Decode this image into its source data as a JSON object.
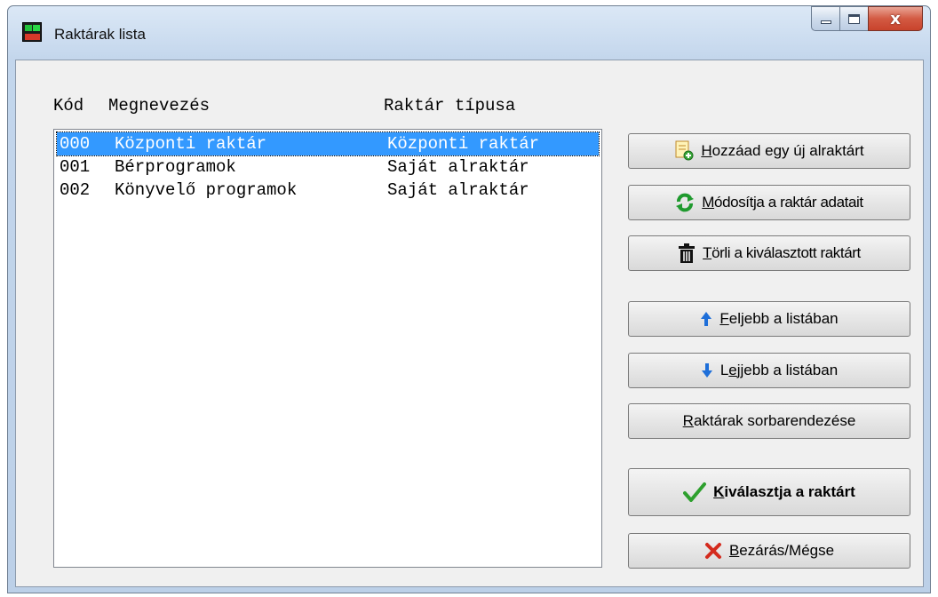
{
  "window": {
    "title": "Raktárak lista",
    "close_glyph": "x"
  },
  "list": {
    "headers": {
      "code": "Kód",
      "name": "Megnevezés",
      "type": "Raktár típusa"
    },
    "rows": [
      {
        "code": "000",
        "name": "Központi raktár",
        "type": "Központi raktár",
        "selected": true
      },
      {
        "code": "001",
        "name": "Bérprogramok",
        "type": "Saját alraktár",
        "selected": false
      },
      {
        "code": "002",
        "name": "Könyvelő programok",
        "type": "Saját alraktár",
        "selected": false
      }
    ]
  },
  "buttons": {
    "add": {
      "mnemonic": "H",
      "rest": "ozzáad egy új alraktárt",
      "icon": "add-document-icon"
    },
    "modify": {
      "mnemonic": "M",
      "rest": "ódosítja a raktár adatait",
      "icon": "refresh-icon"
    },
    "delete": {
      "mnemonic": "T",
      "rest": "örli a kiválasztott raktárt",
      "icon": "trash-icon"
    },
    "up": {
      "mnemonic": "F",
      "rest": "eljebb a listában",
      "icon": "arrow-up-icon"
    },
    "down": {
      "pre": "L",
      "mnemonic": "e",
      "rest": "jjebb a listában",
      "icon": "arrow-down-icon"
    },
    "sort": {
      "mnemonic": "R",
      "rest": "aktárak sorbarendezése"
    },
    "select": {
      "mnemonic": "K",
      "rest": "iválasztja a raktárt",
      "icon": "checkmark-icon"
    },
    "close": {
      "mnemonic": "B",
      "rest": "ezárás/Mégse",
      "icon": "x-mark-icon"
    }
  },
  "colors": {
    "selection": "#3399ff",
    "check_green": "#2ea02e",
    "close_red": "#d42b1e",
    "arrow_blue": "#1e6fd9"
  }
}
